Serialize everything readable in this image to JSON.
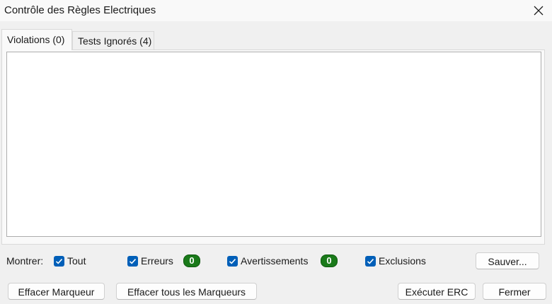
{
  "window": {
    "title": "Contrôle des Règles Electriques",
    "close_icon": "close-icon"
  },
  "tabs": [
    {
      "label": "Violations (0)",
      "active": true
    },
    {
      "label": "Tests Ignorés (4)",
      "active": false
    }
  ],
  "violations": [],
  "filters": {
    "label": "Montrer:",
    "all": {
      "label": "Tout",
      "checked": true
    },
    "errors": {
      "label": "Erreurs",
      "checked": true,
      "count": "0"
    },
    "warnings": {
      "label": "Avertissements",
      "checked": true,
      "count": "0"
    },
    "exclusions": {
      "label": "Exclusions",
      "checked": true
    }
  },
  "buttons": {
    "save": "Sauver...",
    "clear_marker": "Effacer Marqueur",
    "clear_all_markers": "Effacer tous les Marqueurs",
    "run_erc": "Exécuter ERC",
    "close": "Fermer"
  },
  "colors": {
    "accent": "#005fb8",
    "badge_green": "#1a7a1a"
  }
}
